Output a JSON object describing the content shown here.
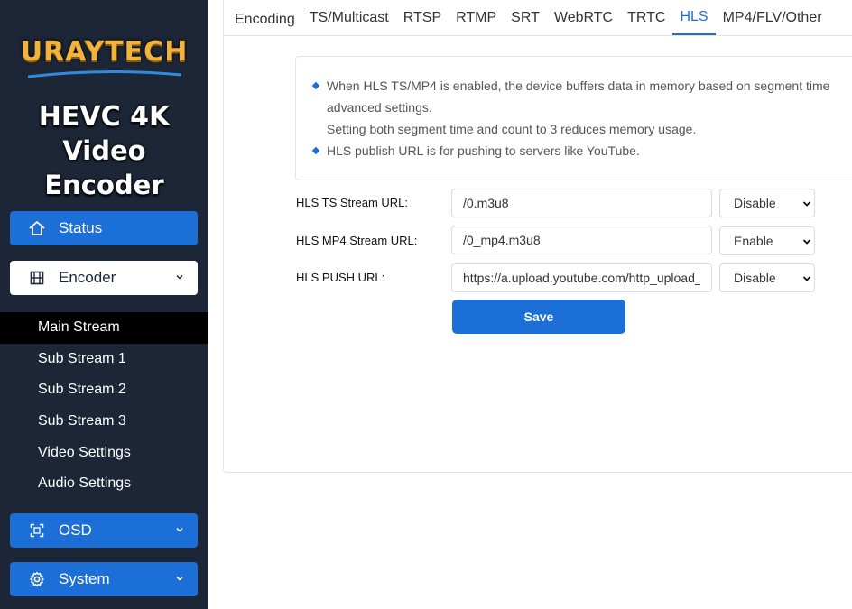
{
  "brand": {
    "logo_text": "URAYTECH",
    "product_line1": "HEVC 4K",
    "product_line2": "Video Encoder"
  },
  "sidebar": {
    "status": {
      "label": "Status",
      "icon": "home-icon"
    },
    "encoder": {
      "label": "Encoder",
      "icon": "film-icon"
    },
    "encoder_items": [
      {
        "label": "Main Stream"
      },
      {
        "label": "Sub Stream 1"
      },
      {
        "label": "Sub Stream 2"
      },
      {
        "label": "Sub Stream 3"
      },
      {
        "label": "Video Settings"
      },
      {
        "label": "Audio Settings"
      }
    ],
    "osd": {
      "label": "OSD",
      "icon": "osd-icon"
    },
    "system": {
      "label": "System",
      "icon": "gear-icon"
    }
  },
  "tabs": [
    {
      "label": "Encoding"
    },
    {
      "label": "TS/Multicast"
    },
    {
      "label": "RTSP"
    },
    {
      "label": "RTMP"
    },
    {
      "label": "SRT"
    },
    {
      "label": "WebRTC"
    },
    {
      "label": "TRTC"
    },
    {
      "label": "HLS"
    },
    {
      "label": "MP4/FLV/Other"
    }
  ],
  "notes": {
    "note1_line1": "When HLS TS/MP4 is enabled, the device buffers data in memory based on segment time",
    "note1_line2": "advanced settings.",
    "note1_line3": "Setting both segment time and count to 3 reduces memory usage.",
    "note2": "HLS publish URL is for pushing to servers like YouTube."
  },
  "form": {
    "ts": {
      "label": "HLS TS Stream URL:",
      "value": "/0.m3u8",
      "state": "Disable"
    },
    "mp4": {
      "label": "HLS MP4 Stream URL:",
      "value": "/0_mp4.m3u8",
      "state": "Enable"
    },
    "push": {
      "label": "HLS PUSH URL:",
      "value": "https://a.upload.youtube.com/http_upload_h",
      "state": "Disable"
    },
    "save_label": "Save"
  },
  "colors": {
    "sidebar_bg": "#1c2636",
    "accent": "#1d6fd8",
    "logo_gold": "#f2b33c"
  }
}
